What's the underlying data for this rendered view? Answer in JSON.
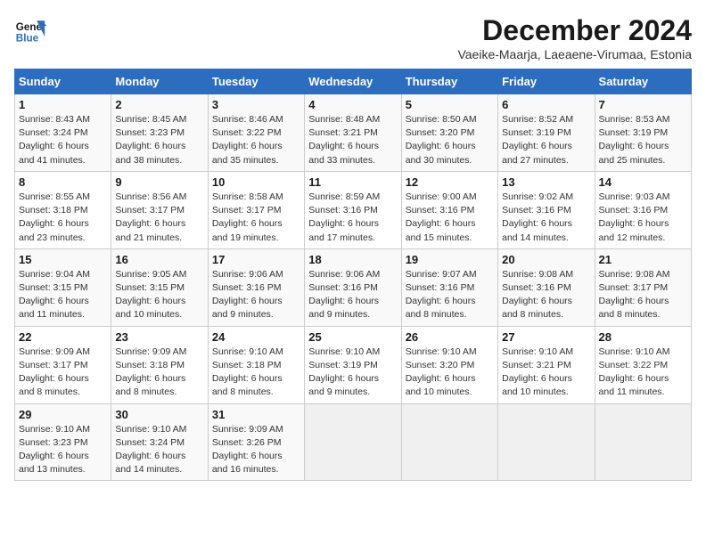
{
  "header": {
    "logo_line1": "General",
    "logo_line2": "Blue",
    "month": "December 2024",
    "location": "Vaeike-Maarja, Laeaene-Virumaa, Estonia"
  },
  "days_of_week": [
    "Sunday",
    "Monday",
    "Tuesday",
    "Wednesday",
    "Thursday",
    "Friday",
    "Saturday"
  ],
  "weeks": [
    [
      {
        "day": 1,
        "info": "Sunrise: 8:43 AM\nSunset: 3:24 PM\nDaylight: 6 hours\nand 41 minutes."
      },
      {
        "day": 2,
        "info": "Sunrise: 8:45 AM\nSunset: 3:23 PM\nDaylight: 6 hours\nand 38 minutes."
      },
      {
        "day": 3,
        "info": "Sunrise: 8:46 AM\nSunset: 3:22 PM\nDaylight: 6 hours\nand 35 minutes."
      },
      {
        "day": 4,
        "info": "Sunrise: 8:48 AM\nSunset: 3:21 PM\nDaylight: 6 hours\nand 33 minutes."
      },
      {
        "day": 5,
        "info": "Sunrise: 8:50 AM\nSunset: 3:20 PM\nDaylight: 6 hours\nand 30 minutes."
      },
      {
        "day": 6,
        "info": "Sunrise: 8:52 AM\nSunset: 3:19 PM\nDaylight: 6 hours\nand 27 minutes."
      },
      {
        "day": 7,
        "info": "Sunrise: 8:53 AM\nSunset: 3:19 PM\nDaylight: 6 hours\nand 25 minutes."
      }
    ],
    [
      {
        "day": 8,
        "info": "Sunrise: 8:55 AM\nSunset: 3:18 PM\nDaylight: 6 hours\nand 23 minutes."
      },
      {
        "day": 9,
        "info": "Sunrise: 8:56 AM\nSunset: 3:17 PM\nDaylight: 6 hours\nand 21 minutes."
      },
      {
        "day": 10,
        "info": "Sunrise: 8:58 AM\nSunset: 3:17 PM\nDaylight: 6 hours\nand 19 minutes."
      },
      {
        "day": 11,
        "info": "Sunrise: 8:59 AM\nSunset: 3:16 PM\nDaylight: 6 hours\nand 17 minutes."
      },
      {
        "day": 12,
        "info": "Sunrise: 9:00 AM\nSunset: 3:16 PM\nDaylight: 6 hours\nand 15 minutes."
      },
      {
        "day": 13,
        "info": "Sunrise: 9:02 AM\nSunset: 3:16 PM\nDaylight: 6 hours\nand 14 minutes."
      },
      {
        "day": 14,
        "info": "Sunrise: 9:03 AM\nSunset: 3:16 PM\nDaylight: 6 hours\nand 12 minutes."
      }
    ],
    [
      {
        "day": 15,
        "info": "Sunrise: 9:04 AM\nSunset: 3:15 PM\nDaylight: 6 hours\nand 11 minutes."
      },
      {
        "day": 16,
        "info": "Sunrise: 9:05 AM\nSunset: 3:15 PM\nDaylight: 6 hours\nand 10 minutes."
      },
      {
        "day": 17,
        "info": "Sunrise: 9:06 AM\nSunset: 3:16 PM\nDaylight: 6 hours\nand 9 minutes."
      },
      {
        "day": 18,
        "info": "Sunrise: 9:06 AM\nSunset: 3:16 PM\nDaylight: 6 hours\nand 9 minutes."
      },
      {
        "day": 19,
        "info": "Sunrise: 9:07 AM\nSunset: 3:16 PM\nDaylight: 6 hours\nand 8 minutes."
      },
      {
        "day": 20,
        "info": "Sunrise: 9:08 AM\nSunset: 3:16 PM\nDaylight: 6 hours\nand 8 minutes."
      },
      {
        "day": 21,
        "info": "Sunrise: 9:08 AM\nSunset: 3:17 PM\nDaylight: 6 hours\nand 8 minutes."
      }
    ],
    [
      {
        "day": 22,
        "info": "Sunrise: 9:09 AM\nSunset: 3:17 PM\nDaylight: 6 hours\nand 8 minutes."
      },
      {
        "day": 23,
        "info": "Sunrise: 9:09 AM\nSunset: 3:18 PM\nDaylight: 6 hours\nand 8 minutes."
      },
      {
        "day": 24,
        "info": "Sunrise: 9:10 AM\nSunset: 3:18 PM\nDaylight: 6 hours\nand 8 minutes."
      },
      {
        "day": 25,
        "info": "Sunrise: 9:10 AM\nSunset: 3:19 PM\nDaylight: 6 hours\nand 9 minutes."
      },
      {
        "day": 26,
        "info": "Sunrise: 9:10 AM\nSunset: 3:20 PM\nDaylight: 6 hours\nand 10 minutes."
      },
      {
        "day": 27,
        "info": "Sunrise: 9:10 AM\nSunset: 3:21 PM\nDaylight: 6 hours\nand 10 minutes."
      },
      {
        "day": 28,
        "info": "Sunrise: 9:10 AM\nSunset: 3:22 PM\nDaylight: 6 hours\nand 11 minutes."
      }
    ],
    [
      {
        "day": 29,
        "info": "Sunrise: 9:10 AM\nSunset: 3:23 PM\nDaylight: 6 hours\nand 13 minutes."
      },
      {
        "day": 30,
        "info": "Sunrise: 9:10 AM\nSunset: 3:24 PM\nDaylight: 6 hours\nand 14 minutes."
      },
      {
        "day": 31,
        "info": "Sunrise: 9:09 AM\nSunset: 3:26 PM\nDaylight: 6 hours\nand 16 minutes."
      },
      null,
      null,
      null,
      null
    ]
  ]
}
